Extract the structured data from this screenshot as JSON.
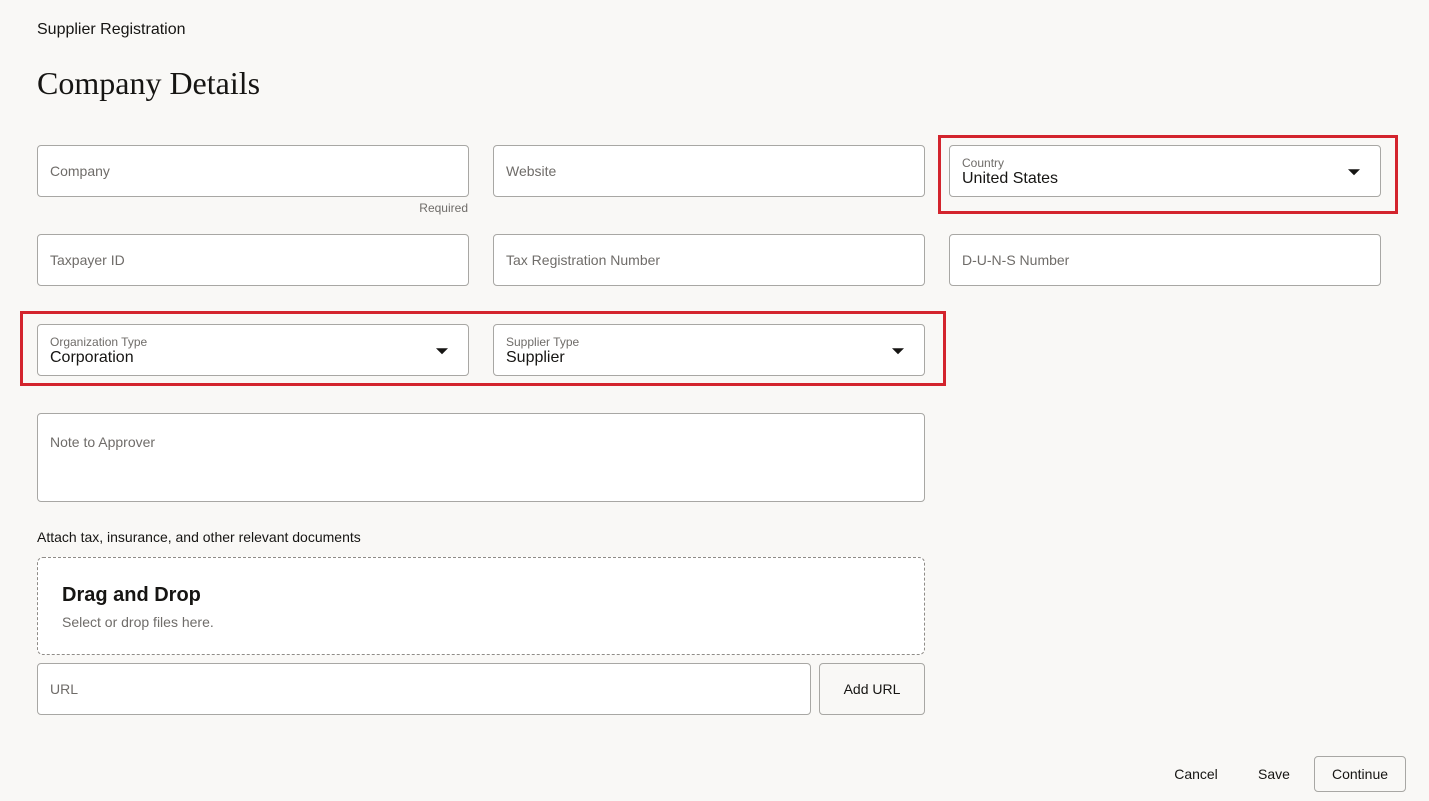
{
  "header": {
    "app_title": "Supplier Registration",
    "page_title": "Company Details"
  },
  "form": {
    "company": {
      "placeholder": "Company",
      "hint": "Required"
    },
    "website": {
      "placeholder": "Website"
    },
    "country": {
      "label": "Country",
      "value": "United States"
    },
    "taxpayer_id": {
      "placeholder": "Taxpayer ID"
    },
    "tax_registration_number": {
      "placeholder": "Tax Registration Number"
    },
    "duns_number": {
      "placeholder": "D-U-N-S Number"
    },
    "organization_type": {
      "label": "Organization Type",
      "value": "Corporation"
    },
    "supplier_type": {
      "label": "Supplier Type",
      "value": "Supplier"
    },
    "note_to_approver": {
      "placeholder": "Note to Approver"
    }
  },
  "attachments": {
    "label": "Attach tax, insurance, and other relevant documents",
    "dropzone_title": "Drag and Drop",
    "dropzone_subtitle": "Select or drop files here.",
    "url_placeholder": "URL",
    "add_url_label": "Add URL"
  },
  "footer": {
    "cancel_label": "Cancel",
    "save_label": "Save",
    "continue_label": "Continue"
  },
  "colors": {
    "highlight": "#d3242d",
    "background": "#f9f8f6",
    "field_border": "#a8a7a4"
  },
  "icons": {
    "dropdown": "caret-down-icon"
  }
}
